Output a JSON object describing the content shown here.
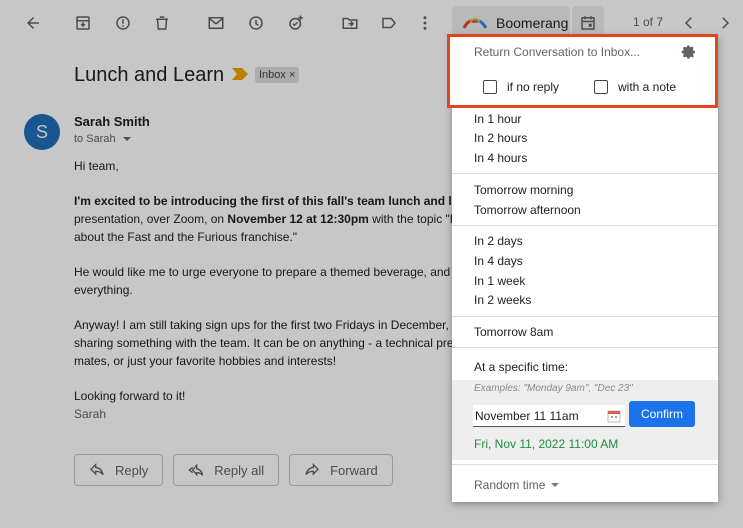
{
  "toolbar": {
    "boomerang_label": "Boomerang",
    "pager": "1 of 7"
  },
  "message": {
    "subject": "Lunch and Learn",
    "label_chip": "Inbox",
    "avatar_letter": "S",
    "sender": "Sarah Smith",
    "to": "to Sarah",
    "greeting": "Hi team,",
    "p1_bold": "I'm excited to be introducing the first of this fall's team lunch and lea",
    "p1_line2a": "presentation, over Zoom, on ",
    "p1_line2_bold": "November 12 at 12:30pm",
    "p1_line2b": " with the topic \"Fa",
    "p1_line3": "about the Fast and the Furious franchise.\"",
    "p2_line1": "He would like me to urge everyone to prepare a themed beverage, and m",
    "p2_line2": "everything.",
    "p3_line1": "Anyway! I am still taking sign ups for the first two Fridays in December, so",
    "p3_line2": "sharing something with the team. It can be on anything - a technical prese",
    "p3_line3": "mates, or just your favorite hobbies and interests!",
    "closing": "Looking forward to it!",
    "signature": "Sarah"
  },
  "actions": {
    "reply": "Reply",
    "reply_all": "Reply all",
    "forward": "Forward"
  },
  "boomerang_menu": {
    "return_title": "Return Conversation to Inbox...",
    "if_no_reply": "if no reply",
    "with_note": "with a note",
    "options_group1": [
      "In 1 hour",
      "In 2 hours",
      "In 4 hours"
    ],
    "options_group2": [
      "Tomorrow morning",
      "Tomorrow afternoon"
    ],
    "options_group3": [
      "In 2 days",
      "In 4 days",
      "In 1 week",
      "In 2 weeks"
    ],
    "options_group4": [
      "Tomorrow 8am"
    ],
    "specific_label": "At a specific time:",
    "examples": "Examples: \"Monday 9am\", \"Dec 23\"",
    "date_value": "November 11 11am",
    "confirm": "Confirm",
    "parsed_time": "Fri, Nov 11, 2022 11:00 AM",
    "random": "Random time"
  },
  "colors": {
    "highlight": "#e0451f",
    "confirm": "#1a73e8",
    "parsed": "#1e8e3e",
    "avatar": "#1e6fb8"
  }
}
